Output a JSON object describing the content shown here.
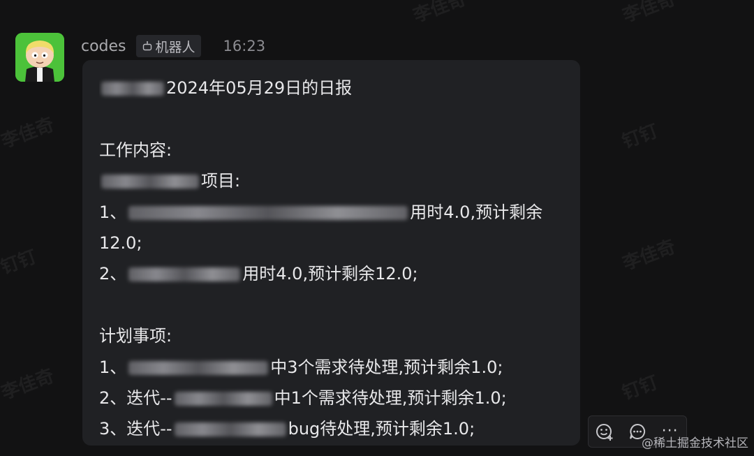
{
  "watermark": "李佳奇",
  "watermark_alt": "钉钉",
  "message": {
    "sender": "codes",
    "bot_tag": "机器人",
    "time": "16:23",
    "lines": [
      {
        "pre": "",
        "blur_w": 90,
        "post": "2024年05月29日的日报"
      },
      {
        "pre": "",
        "blur_w": 0,
        "post": ""
      },
      {
        "pre": "工作内容:",
        "blur_w": 0,
        "post": ""
      },
      {
        "pre": "",
        "blur_w": 140,
        "post": "项目:"
      },
      {
        "pre": "1、",
        "blur_w": 400,
        "post": "用时4.0,预计剩余"
      },
      {
        "pre": "12.0;",
        "blur_w": 0,
        "post": ""
      },
      {
        "pre": "2、",
        "blur_w": 160,
        "post": "用时4.0,预计剩余12.0;"
      },
      {
        "pre": "",
        "blur_w": 0,
        "post": ""
      },
      {
        "pre": "计划事项:",
        "blur_w": 0,
        "post": ""
      },
      {
        "pre": "1、",
        "blur_w": 200,
        "post": "中3个需求待处理,预计剩余1.0;"
      },
      {
        "pre": "2、迭代--",
        "blur_w": 140,
        "post": "中1个需求待处理,预计剩余1.0;"
      },
      {
        "pre": "3、迭代--",
        "blur_w": 160,
        "post": "bug待处理,预计剩余1.0;"
      }
    ]
  },
  "actions": {
    "emoji_icon": "emoji-add-icon",
    "reply_icon": "comment-icon",
    "more_label": "···"
  },
  "credit": "@稀土掘金技术社区"
}
